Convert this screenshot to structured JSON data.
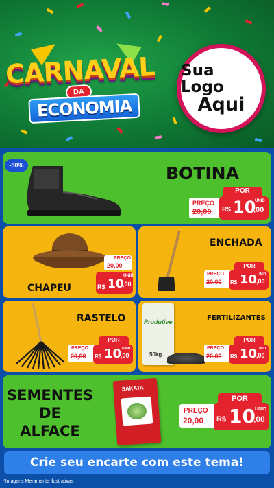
{
  "header": {
    "title_line1": "CARNAVAL",
    "title_da": "DA",
    "title_line2": "ECONOMIA",
    "logo_placeholder_line1": "Sua Logo",
    "logo_placeholder_line2": "Aqui"
  },
  "colors": {
    "header_green": "#0f7a35",
    "card_green": "#4ec02d",
    "card_yellow": "#f6b50e",
    "price_red": "#e5232f",
    "page_blue": "#0c4fa8",
    "cta_blue": "#2f7fe8"
  },
  "products": [
    {
      "name": "BOTINA",
      "discount": "-50%",
      "preco_label": "PREÇO",
      "old_price": "20,00",
      "por_label": "POR",
      "currency": "R$",
      "new_price_int": "10",
      "new_price_dec": ",00",
      "unit": "UNID",
      "icon": "boot-icon"
    },
    {
      "name": "CHAPEU",
      "preco_label": "PREÇO",
      "old_price": "20,00",
      "por_label": "POR",
      "currency": "R$",
      "new_price_int": "10",
      "new_price_dec": ",00",
      "unit": "UNID",
      "icon": "hat-icon"
    },
    {
      "name": "ENCHADA",
      "preco_label": "PREÇO",
      "old_price": "20,00",
      "por_label": "POR",
      "currency": "R$",
      "new_price_int": "10",
      "new_price_dec": ",00",
      "unit": "UNID",
      "icon": "hoe-icon"
    },
    {
      "name": "RASTELO",
      "preco_label": "PREÇO",
      "old_price": "20,00",
      "por_label": "POR",
      "currency": "R$",
      "new_price_int": "10",
      "new_price_dec": ",00",
      "unit": "UNID",
      "icon": "rake-icon"
    },
    {
      "name": "FERTILIZANTES",
      "preco_label": "PREÇO",
      "old_price": "20,00",
      "por_label": "POR",
      "currency": "R$",
      "new_price_int": "10",
      "new_price_dec": ",00",
      "unit": "UNID",
      "icon": "fertilizer-bag-icon",
      "bag_brand": "Produtive",
      "bag_weight": "50kg"
    },
    {
      "name_line1": "SEMENTES",
      "name_line2": "DE",
      "name_line3": "ALFACE",
      "preco_label": "PREÇO",
      "old_price": "20,00",
      "por_label": "POR",
      "currency": "R$",
      "new_price_int": "10",
      "new_price_dec": ",00",
      "unit": "UNID",
      "icon": "seed-packet-icon",
      "packet_brand": "SAKATA"
    }
  ],
  "footer": {
    "cta": "Crie seu encarte com este tema!",
    "disclaimer": "*Imagens Meramente Ilustrativas"
  }
}
